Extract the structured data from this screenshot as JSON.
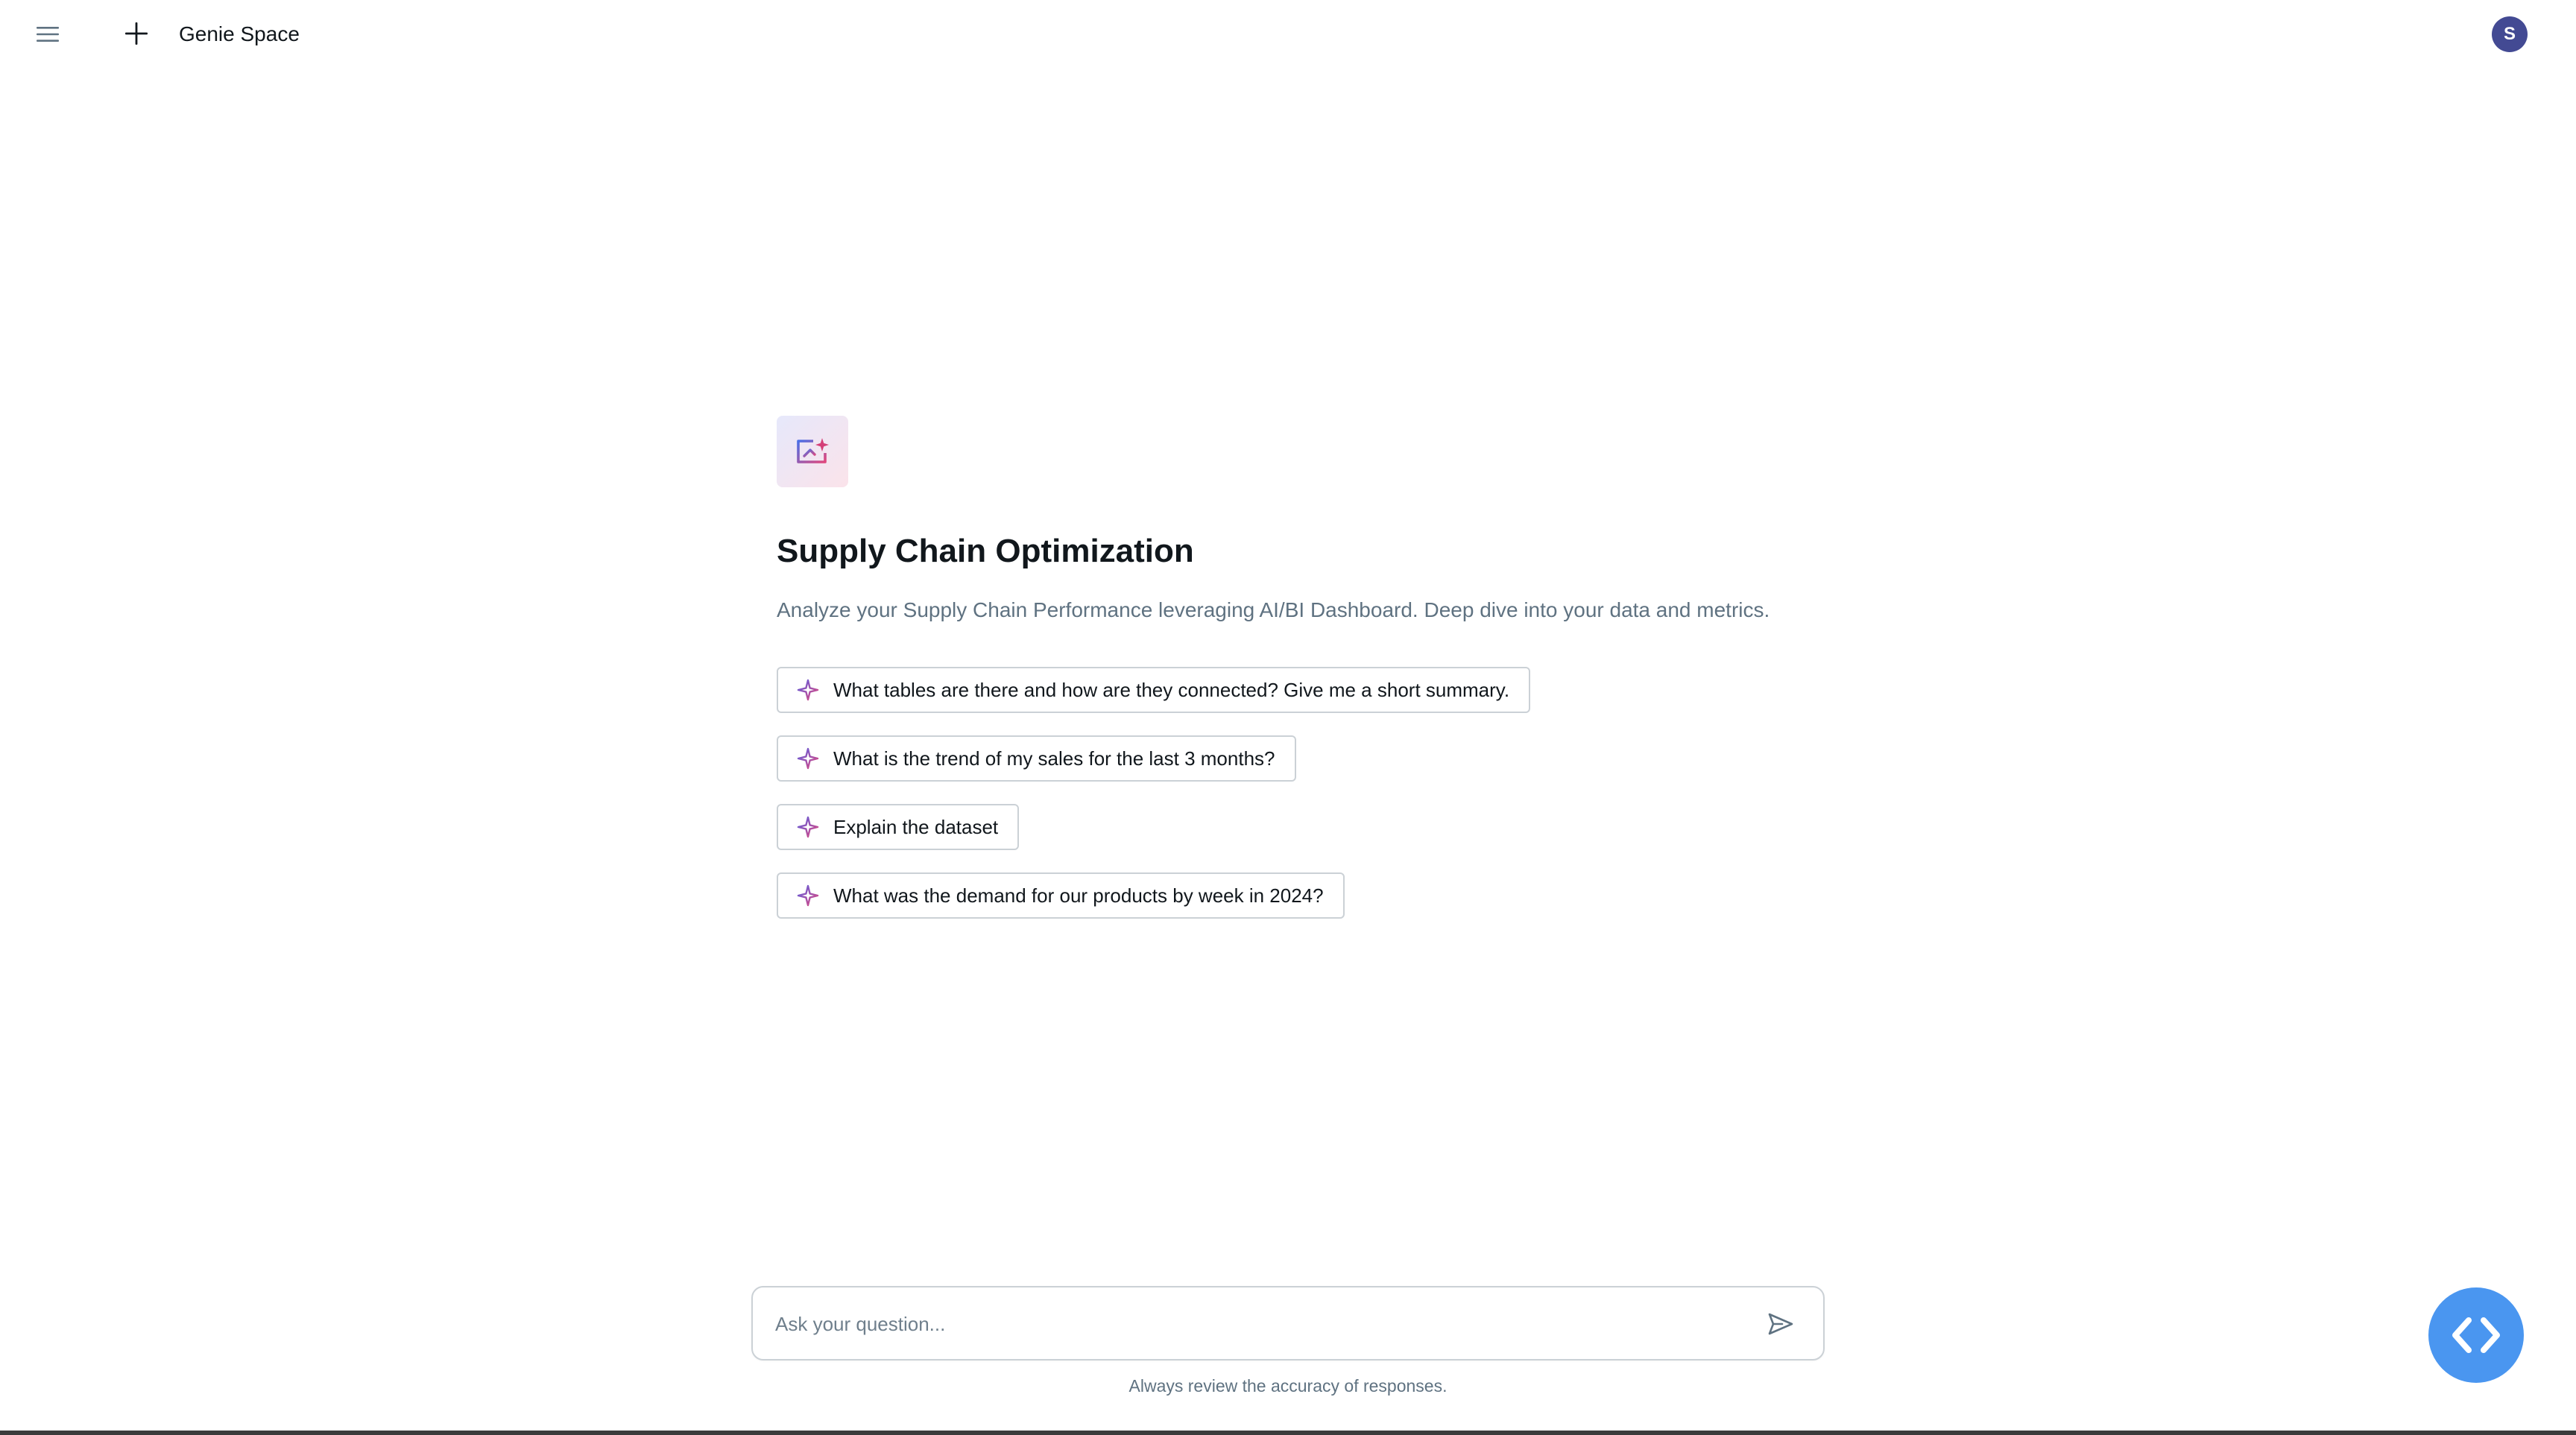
{
  "header": {
    "menu_icon": "hamburger-menu-icon",
    "new_icon": "plus-icon",
    "title": "Genie Space",
    "avatar_initial": "S",
    "avatar_color": "#434a93"
  },
  "space": {
    "logo_icon": "genie-sparkle-chart-icon",
    "title": "Supply Chain Optimization",
    "description": "Analyze your Supply Chain Performance leveraging AI/BI Dashboard. Deep dive into your data and metrics."
  },
  "suggestions": [
    {
      "label": "What tables are there and how are they connected? Give me a short summary.",
      "icon": "sparkle-icon"
    },
    {
      "label": "What is the trend of my sales for the last 3 months?",
      "icon": "sparkle-icon"
    },
    {
      "label": "Explain the dataset",
      "icon": "sparkle-icon"
    },
    {
      "label": "What was the demand for our products by week in 2024?",
      "icon": "sparkle-icon"
    }
  ],
  "input": {
    "placeholder": "Ask your question...",
    "value": "",
    "send_icon": "send-icon"
  },
  "disclaimer": "Always review the accuracy of responses.",
  "fab": {
    "icon": "code-brackets-icon",
    "color": "#4a96f0"
  }
}
